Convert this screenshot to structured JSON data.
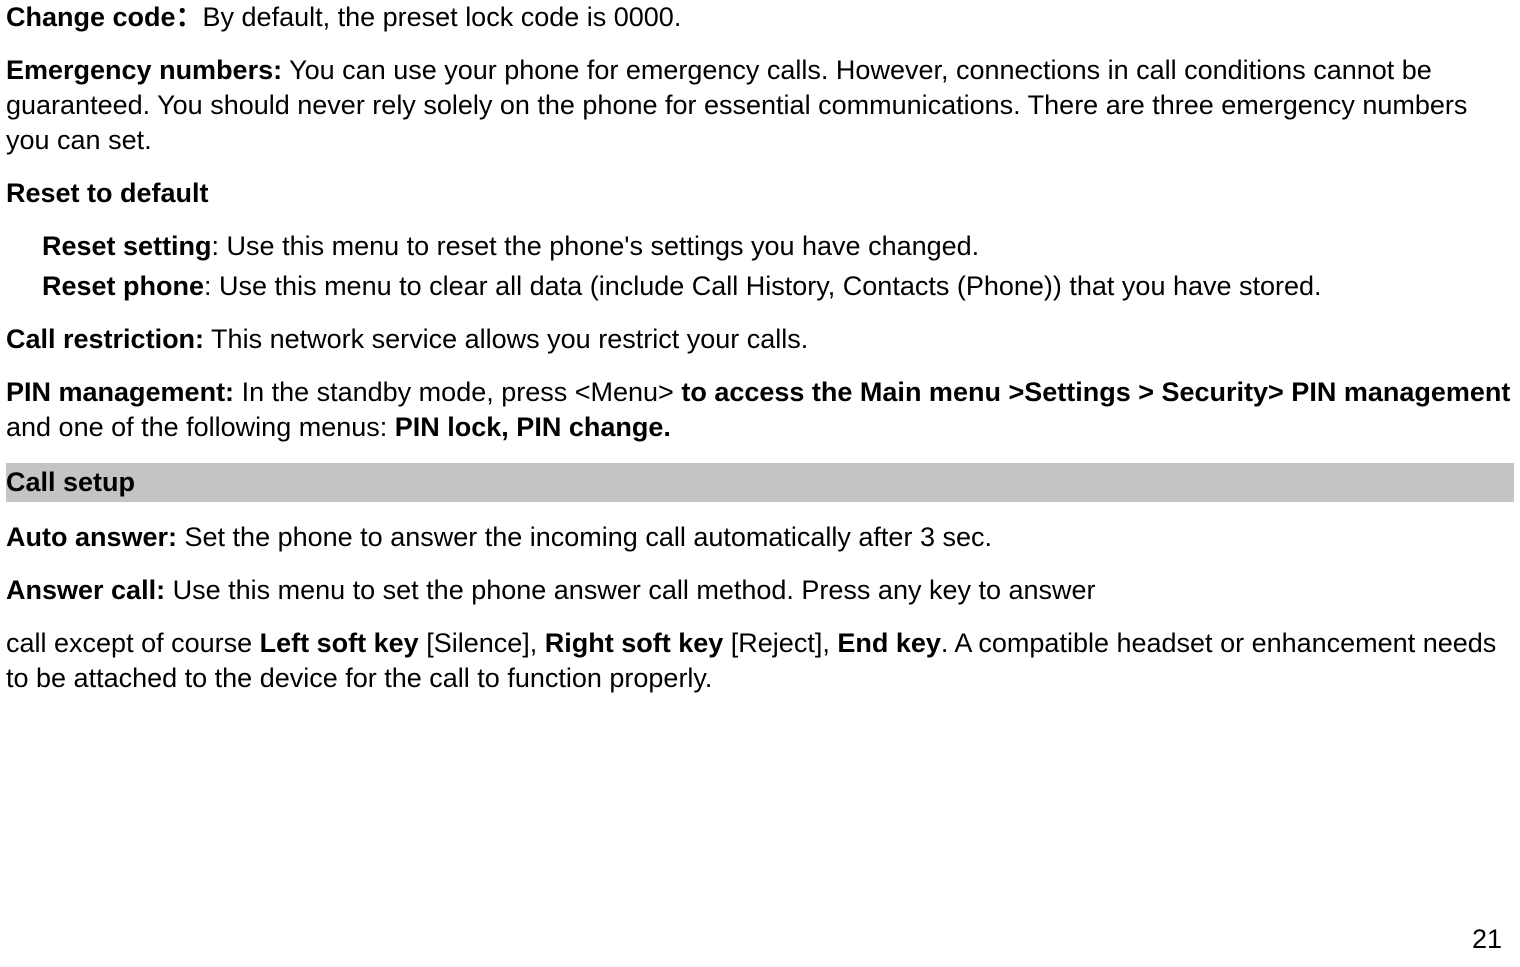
{
  "p1": {
    "label": "Change code：",
    "text": "By default, the preset lock code is 0000."
  },
  "p2": {
    "label": "Emergency numbers:",
    "text": " You can use your phone for emergency calls. However, connections in call conditions cannot be guaranteed. You should never rely solely on the phone for essential communications. There are three emergency numbers you can set."
  },
  "p3": {
    "label": "Reset to default"
  },
  "p4": {
    "label": "Reset setting",
    "text": ": Use this menu to reset the phone's settings you have changed."
  },
  "p5": {
    "label": "Reset phone",
    "text": ": Use this menu to clear all data (include Call History, Contacts (Phone)) that you have stored."
  },
  "p6": {
    "label": "Call restriction:",
    "text": " This network service allows you restrict your calls."
  },
  "p7": {
    "label1": "PIN management:",
    "text1": " In the standby mode, press <Menu> ",
    "label2": "to access the Main menu >Settings > Security> PIN management",
    "text2": " and one of the following menus: ",
    "label3": "PIN lock, PIN change."
  },
  "section": "Call setup",
  "p8": {
    "label": "Auto answer:",
    "text": " Set the phone to answer the incoming call automatically after 3 sec."
  },
  "p9": {
    "label": "Answer call:",
    "text": " Use this menu to set the phone answer call method. Press any key to answer"
  },
  "p10": {
    "text1": "call except of course ",
    "label1": "Left soft key",
    "text2": " [Silence], ",
    "label2": "Right soft key",
    "text3": " [Reject], ",
    "label3": "End key",
    "text4": ". A compatible headset or enhancement needs to be attached to the device for the call to function properly."
  },
  "pageNumber": "21"
}
